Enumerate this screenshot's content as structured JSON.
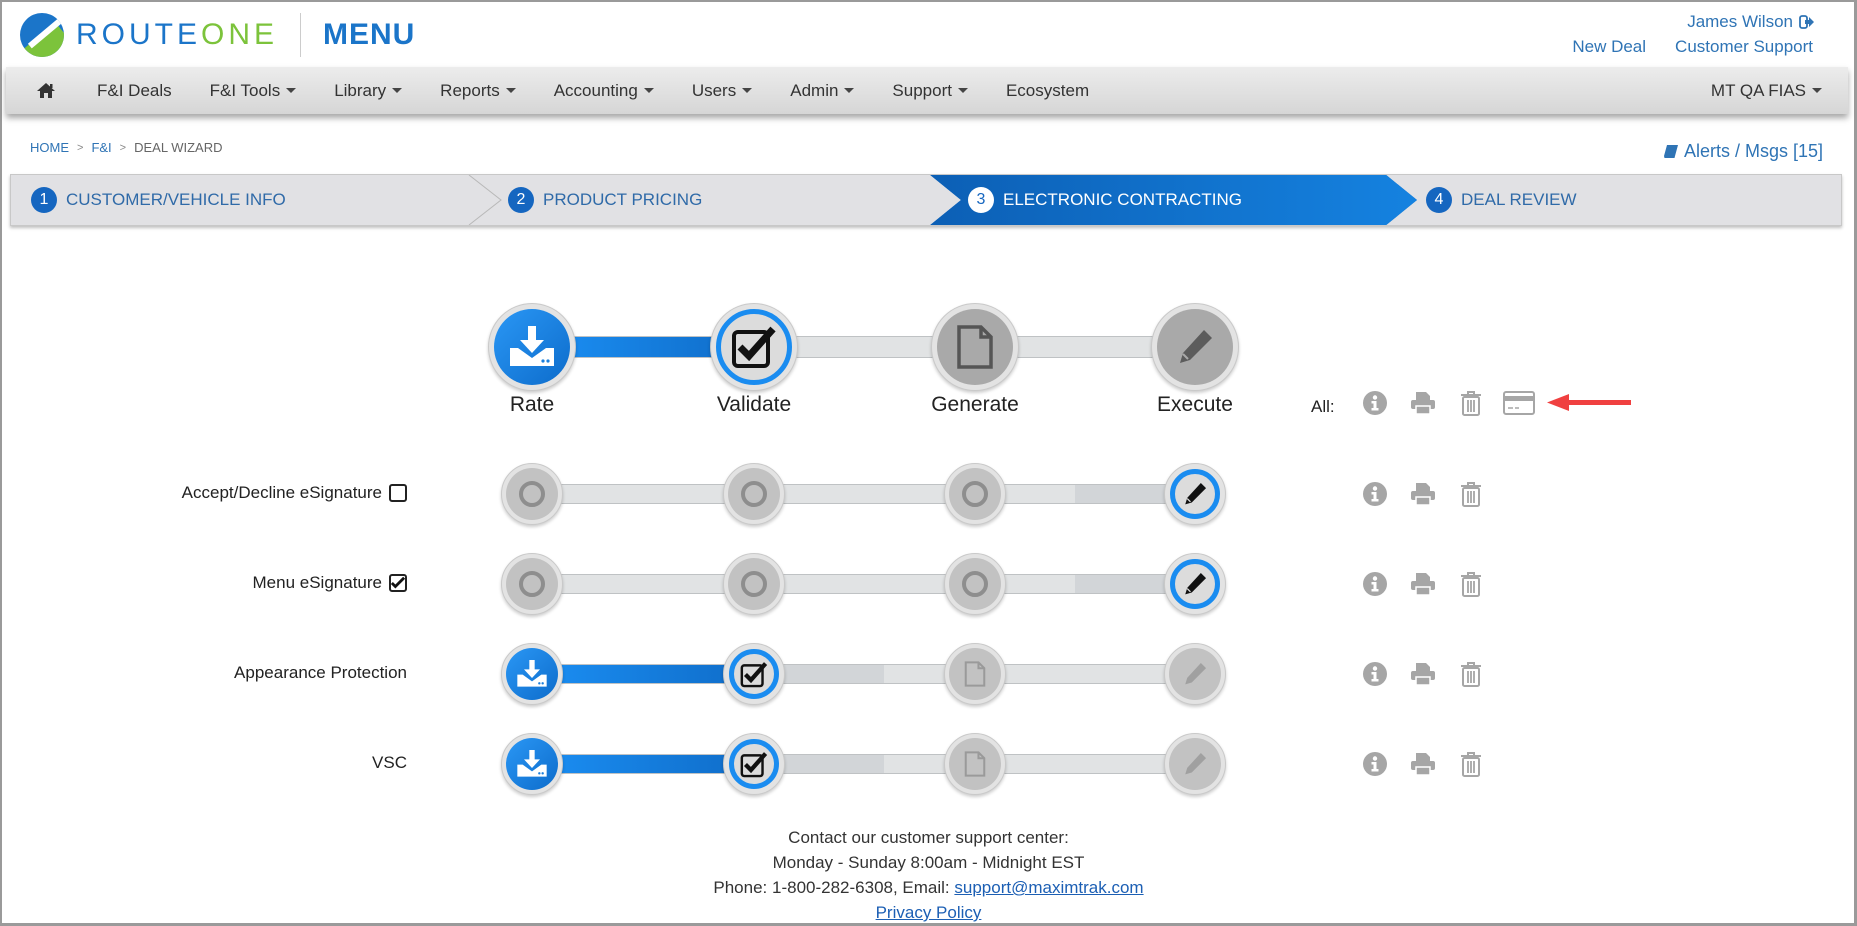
{
  "header": {
    "logo": {
      "part1": "ROUTE",
      "part2": "ONE",
      "product": "MENU"
    },
    "user_name": "James Wilson",
    "links": [
      "New Deal",
      "Customer Support"
    ]
  },
  "nav": {
    "items": [
      {
        "label": "F&I Deals",
        "dropdown": false
      },
      {
        "label": "F&I Tools",
        "dropdown": true
      },
      {
        "label": "Library",
        "dropdown": true
      },
      {
        "label": "Reports",
        "dropdown": true
      },
      {
        "label": "Accounting",
        "dropdown": true
      },
      {
        "label": "Users",
        "dropdown": true
      },
      {
        "label": "Admin",
        "dropdown": true
      },
      {
        "label": "Support",
        "dropdown": true
      },
      {
        "label": "Ecosystem",
        "dropdown": false
      }
    ],
    "dealer": "MT QA FIAS"
  },
  "breadcrumb": [
    "HOME",
    "F&I",
    "DEAL WIZARD"
  ],
  "alerts": "Alerts / Msgs [15]",
  "wizard": {
    "steps": [
      {
        "num": "1",
        "label": "CUSTOMER/VEHICLE INFO"
      },
      {
        "num": "2",
        "label": "PRODUCT PRICING"
      },
      {
        "num": "3",
        "label": "ELECTRONIC CONTRACTING"
      },
      {
        "num": "4",
        "label": "DEAL REVIEW"
      }
    ],
    "active_step": 3
  },
  "stepper": {
    "stages": [
      "Rate",
      "Validate",
      "Generate",
      "Execute"
    ],
    "all_label": "All:",
    "all_actions": [
      "info",
      "print",
      "delete",
      "payment"
    ]
  },
  "rows": [
    {
      "label": "Accept/Decline eSignature",
      "checkbox": true,
      "checked": false,
      "current_stage": "Execute",
      "completed_stages": []
    },
    {
      "label": "Menu eSignature",
      "checkbox": true,
      "checked": true,
      "current_stage": "Execute",
      "completed_stages": []
    },
    {
      "label": "Appearance Protection",
      "checkbox": false,
      "current_stage": "Validate",
      "completed_stages": [
        "Rate"
      ]
    },
    {
      "label": "VSC",
      "checkbox": false,
      "current_stage": "Validate",
      "completed_stages": [
        "Rate"
      ]
    }
  ],
  "colors": {
    "brand_blue": "#1b75c9",
    "brand_green": "#7cc33b",
    "active_step": "#0f6cc8",
    "annotation_arrow": "#f04040"
  },
  "footer": {
    "line1": "Contact our customer support center:",
    "line2": "Monday - Sunday 8:00am - Midnight EST",
    "line3_prefix": "Phone: 1-800-282-6308, Email: ",
    "email": "support@maximtrak.com",
    "privacy": "Privacy Policy"
  }
}
